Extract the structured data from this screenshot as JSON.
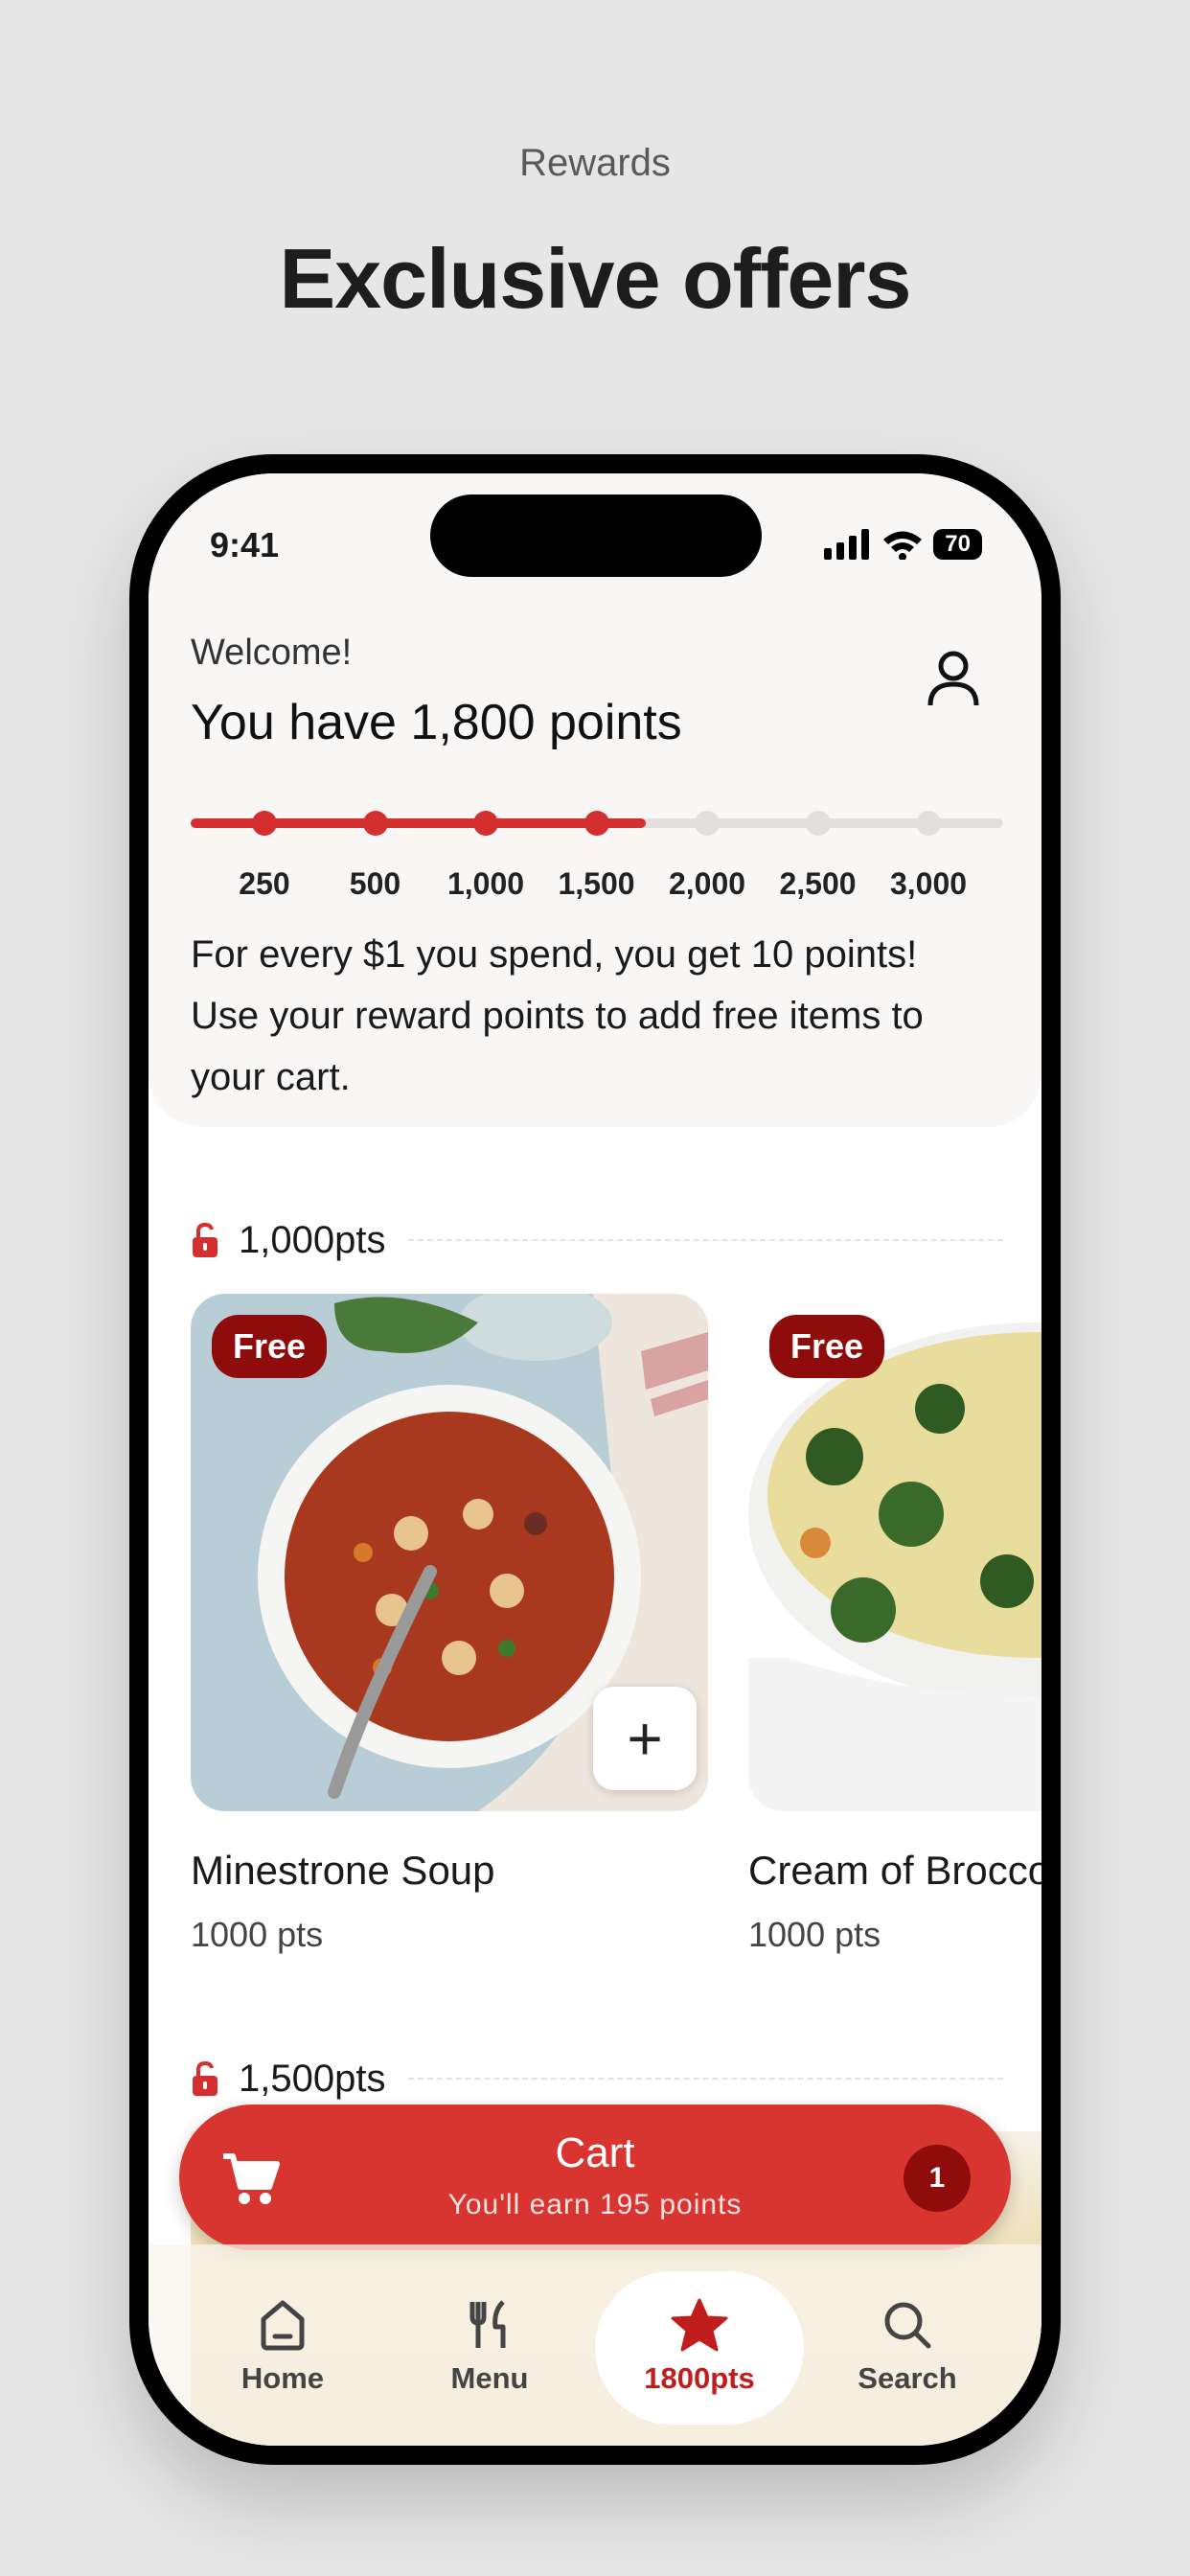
{
  "hero": {
    "subtitle": "Rewards",
    "title": "Exclusive offers"
  },
  "status_bar": {
    "time": "9:41",
    "battery": "70"
  },
  "header": {
    "welcome": "Welcome!",
    "points_title": "You have 1,800 points",
    "current_points": 1800
  },
  "progress": {
    "ticks": [
      "250",
      "500",
      "1,000",
      "1,500",
      "2,000",
      "2,500",
      "3,000"
    ],
    "fraction_filled": 0.56
  },
  "description": "For every $1 you spend, you get 10 points! Use your reward points to add free items to your cart.",
  "sections": [
    {
      "label": "1,000pts"
    },
    {
      "label": "1,500pts"
    }
  ],
  "items": [
    {
      "badge": "Free",
      "name": "Minestrone Soup",
      "points": "1000 pts"
    },
    {
      "badge": "Free",
      "name": "Cream of Broccoli",
      "points": "1000 pts"
    }
  ],
  "cart": {
    "title": "Cart",
    "subtitle": "You'll earn 195 points",
    "count": "1"
  },
  "tabs": [
    {
      "label": "Home",
      "icon": "home-icon"
    },
    {
      "label": "Menu",
      "icon": "utensils-icon"
    },
    {
      "label": "1800pts",
      "icon": "star-icon",
      "active": true
    },
    {
      "label": "Search",
      "icon": "search-icon"
    }
  ],
  "colors": {
    "accent": "#d32f2f",
    "badge": "#8f0c0c",
    "cart": "#d93530",
    "track": "#e4dfdf"
  }
}
